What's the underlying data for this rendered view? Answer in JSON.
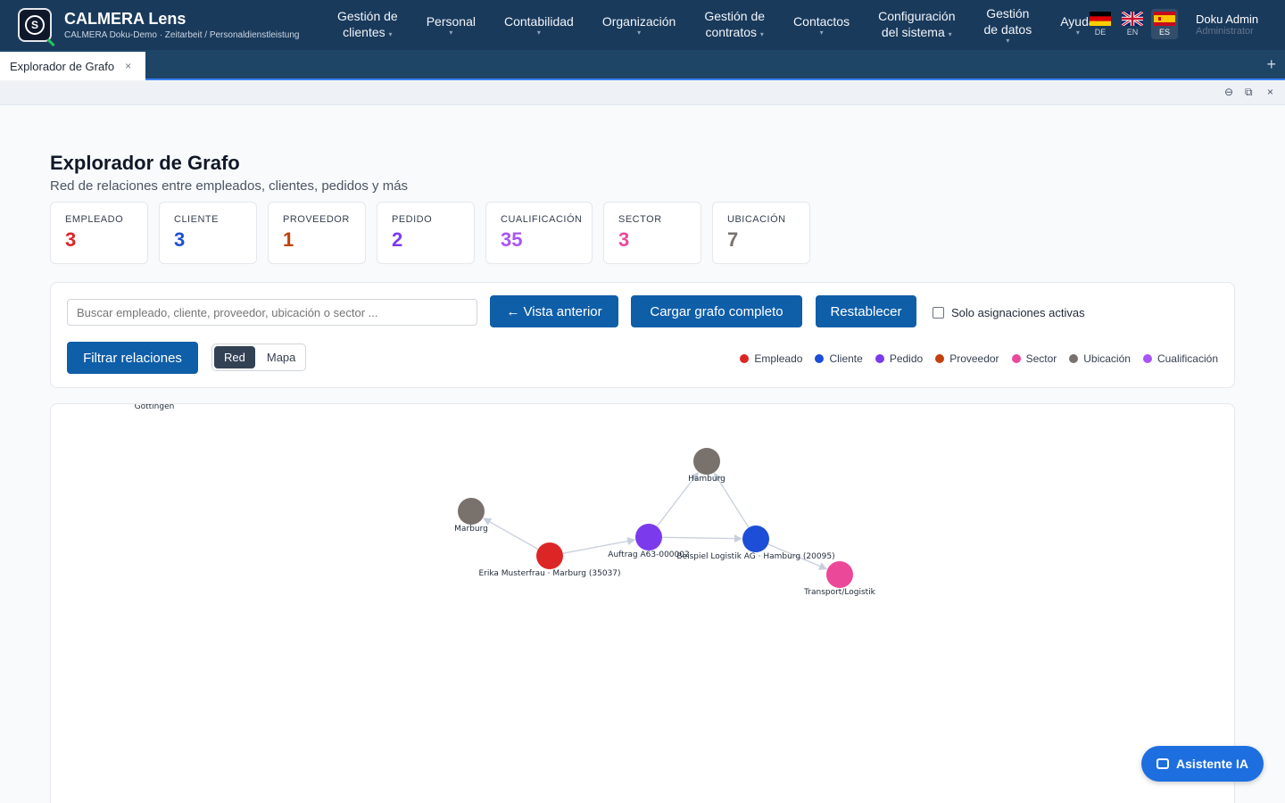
{
  "app": {
    "title": "CALMERA Lens",
    "subtitle": "CALMERA Doku-Demo · Zeitarbeit / Personaldienstleistung"
  },
  "nav": [
    {
      "line1": "Gestión de",
      "line2": "clientes"
    },
    {
      "line1": "Personal",
      "line2": ""
    },
    {
      "line1": "Contabilidad",
      "line2": ""
    },
    {
      "line1": "Organización",
      "line2": ""
    },
    {
      "line1": "Gestión de",
      "line2": "contratos"
    },
    {
      "line1": "Contactos",
      "line2": ""
    },
    {
      "line1": "Configuración",
      "line2": "del sistema"
    },
    {
      "line1": "Gestión",
      "line2": "de datos"
    },
    {
      "line1": "Ayuda",
      "line2": ""
    }
  ],
  "languages": [
    {
      "code": "DE",
      "active": false
    },
    {
      "code": "EN",
      "active": false
    },
    {
      "code": "ES",
      "active": true
    }
  ],
  "user": {
    "name": "Doku Admin",
    "role": "Administrator"
  },
  "tabs": [
    {
      "label": "Explorador de Grafo",
      "close": "×"
    }
  ],
  "tab_add": "+",
  "window_controls": {
    "minimize": "⊖",
    "restore": "⧉",
    "close": "×"
  },
  "page": {
    "title": "Explorador de Grafo",
    "subtitle": "Red de relaciones entre empleados, clientes, pedidos y más"
  },
  "stats": [
    {
      "label": "EMPLEADO",
      "value": "3",
      "color": "#dc2626"
    },
    {
      "label": "CLIENTE",
      "value": "3",
      "color": "#1d4ed8"
    },
    {
      "label": "PROVEEDOR",
      "value": "1",
      "color": "#c2410c"
    },
    {
      "label": "PEDIDO",
      "value": "2",
      "color": "#7c3aed"
    },
    {
      "label": "CUALIFICACIÓN",
      "value": "35",
      "color": "#a855f7"
    },
    {
      "label": "SECTOR",
      "value": "3",
      "color": "#ec4899"
    },
    {
      "label": "UBICACIÓN",
      "value": "7",
      "color": "#78716c"
    }
  ],
  "controls": {
    "search_placeholder": "Buscar empleado, cliente, proveedor, ubicación o sector ...",
    "back_label": "← Vista anterior",
    "load_label": "Cargar grafo completo",
    "reset_label": "Restablecer",
    "active_only_label": "Solo asignaciones activas",
    "filter_label": "Filtrar relaciones",
    "view_network": "Red",
    "view_map": "Mapa"
  },
  "legend": [
    {
      "label": "Empleado",
      "color": "#dc2626"
    },
    {
      "label": "Cliente",
      "color": "#1d4ed8"
    },
    {
      "label": "Pedido",
      "color": "#7c3aed"
    },
    {
      "label": "Proveedor",
      "color": "#c2410c"
    },
    {
      "label": "Sector",
      "color": "#ec4899"
    },
    {
      "label": "Ubicación",
      "color": "#78716c"
    },
    {
      "label": "Cualificación",
      "color": "#a855f7"
    }
  ],
  "graph": {
    "nodes": [
      {
        "id": "hamburg",
        "label": "Hamburg",
        "type": "Ubicación",
        "color": "#78716c"
      },
      {
        "id": "marburg",
        "label": "Marburg",
        "type": "Ubicación",
        "color": "#78716c"
      },
      {
        "id": "erika",
        "label": "Erika Musterfrau · Marburg (35037)",
        "type": "Empleado",
        "color": "#dc2626"
      },
      {
        "id": "auftrag",
        "label": "Auftrag A63-000002",
        "type": "Pedido",
        "color": "#7c3aed"
      },
      {
        "id": "beispiel",
        "label": "Beispiel Logistik AG · Hamburg (20095)",
        "type": "Cliente",
        "color": "#1d4ed8"
      },
      {
        "id": "transport",
        "label": "Transport/Logistik",
        "type": "Sector",
        "color": "#ec4899"
      }
    ],
    "offscreen_label": "Göttingen",
    "edges": [
      {
        "from": "erika",
        "to": "marburg"
      },
      {
        "from": "erika",
        "to": "auftrag"
      },
      {
        "from": "auftrag",
        "to": "beispiel"
      },
      {
        "from": "auftrag",
        "to": "hamburg"
      },
      {
        "from": "beispiel",
        "to": "hamburg"
      },
      {
        "from": "beispiel",
        "to": "transport"
      }
    ]
  },
  "assistant_label": "Asistente IA"
}
